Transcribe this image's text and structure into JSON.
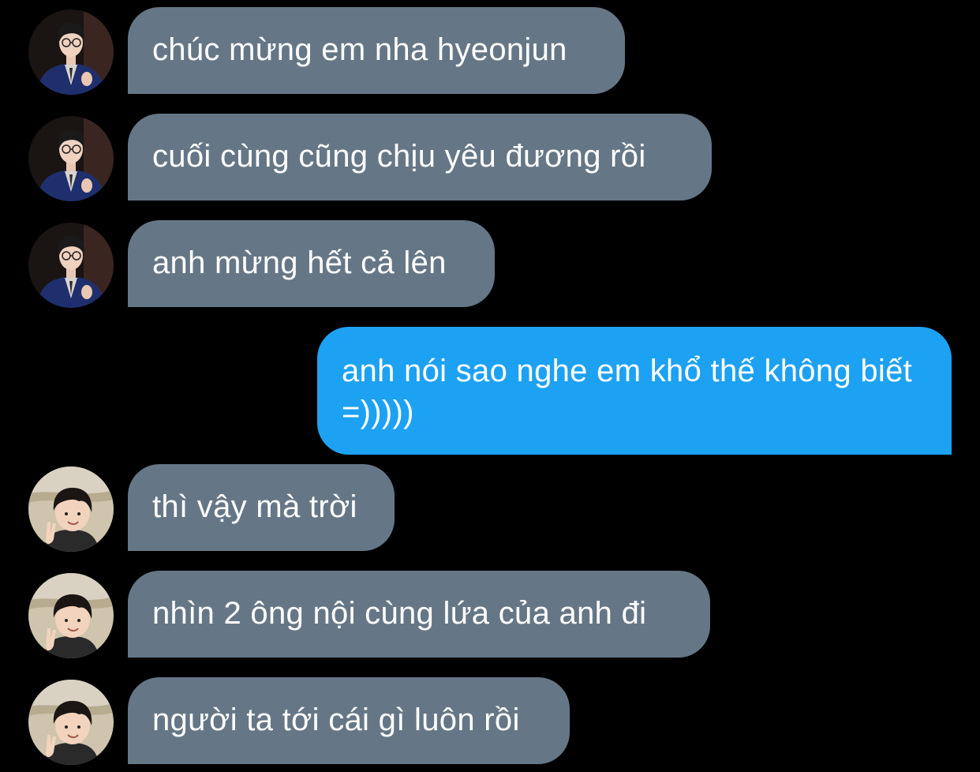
{
  "chat": {
    "messages": [
      {
        "direction": "incoming",
        "avatar": "man-in-suit-avatar",
        "text": "chúc mừng em nha hyeonjun"
      },
      {
        "direction": "incoming",
        "avatar": "man-in-suit-avatar",
        "text": "cuối cùng cũng chịu yêu đương rồi"
      },
      {
        "direction": "incoming",
        "avatar": "man-in-suit-avatar",
        "text": "anh mừng hết cả lên"
      },
      {
        "direction": "outgoing",
        "text": "anh nói sao nghe em khổ thế không biết =)))))"
      },
      {
        "direction": "incoming",
        "avatar": "child-peace-sign-avatar",
        "text": "thì vậy mà trời"
      },
      {
        "direction": "incoming",
        "avatar": "child-peace-sign-avatar",
        "text": "nhìn 2 ông nội cùng lứa của anh đi"
      },
      {
        "direction": "incoming",
        "avatar": "child-peace-sign-avatar",
        "text": "người ta tới cái gì luôn rồi"
      }
    ]
  },
  "colors": {
    "background": "#000000",
    "incoming_bubble": "#657786",
    "outgoing_bubble": "#1da1f2",
    "text": "#ffffff"
  }
}
